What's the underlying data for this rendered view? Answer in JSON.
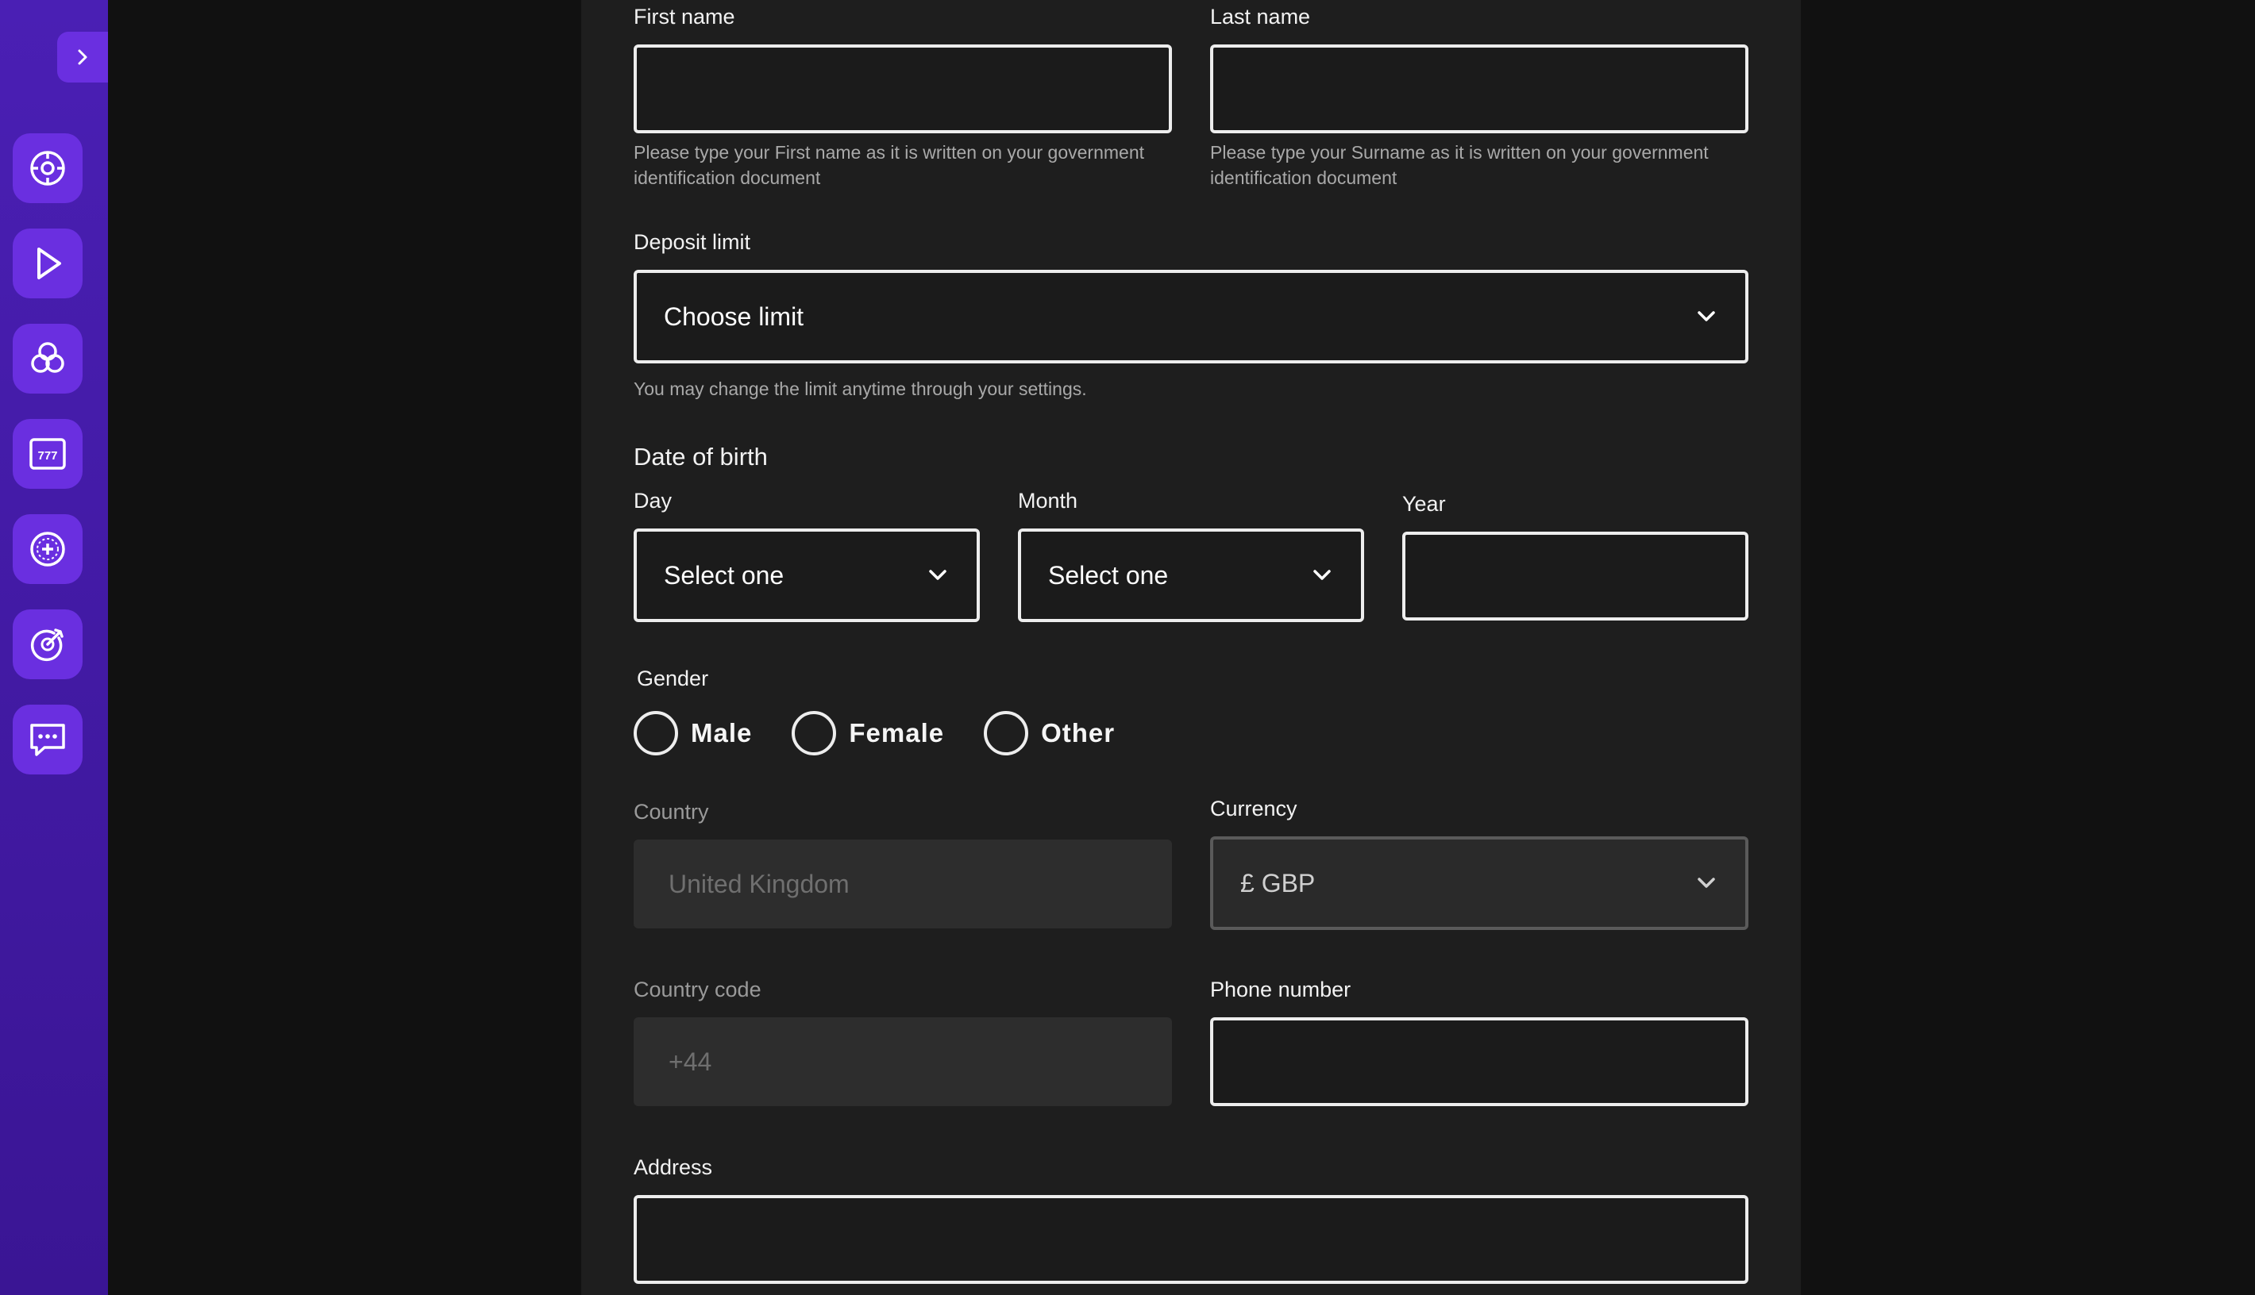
{
  "sidebar": {
    "expand_icon": "chevron-right-icon",
    "items": [
      {
        "name": "nav-item-roulette",
        "icon": "roulette-wheel-icon"
      },
      {
        "name": "nav-item-live",
        "icon": "play-icon"
      },
      {
        "name": "nav-item-featured",
        "icon": "trefoil-icon"
      },
      {
        "name": "nav-item-slots",
        "icon": "slot-machine-icon"
      },
      {
        "name": "nav-item-table-games",
        "icon": "chip-icon"
      },
      {
        "name": "nav-item-sports",
        "icon": "dart-target-icon"
      },
      {
        "name": "nav-item-chat",
        "icon": "chat-bubble-icon"
      }
    ],
    "colors": {
      "sidebar": "#4a1fb4",
      "button": "#6a2fe0"
    }
  },
  "form": {
    "first_name": {
      "label": "First name",
      "value": "",
      "hint": "Please type your First name as it is written on your government identification document"
    },
    "last_name": {
      "label": "Last name",
      "value": "",
      "hint": "Please type your Surname as it is written on your government identification document"
    },
    "deposit_limit": {
      "label": "Deposit limit",
      "selected": "Choose limit",
      "hint": "You may change the limit anytime through your settings."
    },
    "dob": {
      "heading": "Date of birth",
      "day": {
        "label": "Day",
        "selected": "Select one"
      },
      "month": {
        "label": "Month",
        "selected": "Select one"
      },
      "year": {
        "label": "Year",
        "value": ""
      }
    },
    "gender": {
      "label": "Gender",
      "options": [
        "Male",
        "Female",
        "Other"
      ]
    },
    "country": {
      "label": "Country",
      "value": "United Kingdom"
    },
    "currency": {
      "label": "Currency",
      "selected": "£ GBP"
    },
    "country_code": {
      "label": "Country code",
      "value": "+44"
    },
    "phone": {
      "label": "Phone number",
      "value": ""
    },
    "address": {
      "label": "Address",
      "value": ""
    }
  }
}
